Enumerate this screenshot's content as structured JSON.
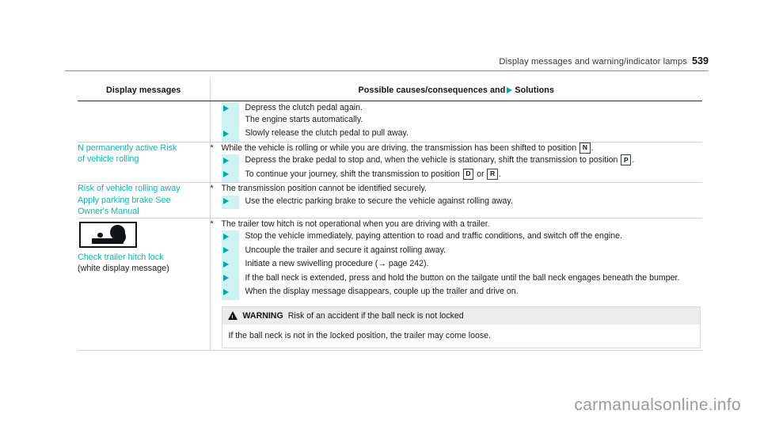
{
  "page_header": {
    "title": "Display messages and warning/indicator lamps",
    "page_number": "539"
  },
  "table": {
    "columns": [
      {
        "label": "Display messages"
      },
      {
        "label_before_icon": "Possible causes/consequences and",
        "icon": "solid-triangle-icon",
        "label_after_icon": "Solutions"
      }
    ],
    "rows": [
      {
        "display_message_lines": [],
        "causes": [
          {
            "marker": "",
            "text": "",
            "solutions": [
              "Depress the clutch pedal again.\nThe engine starts automatically.",
              "Slowly release the clutch pedal to pull away."
            ]
          }
        ]
      },
      {
        "display_message_lines": [
          "N permanently active Risk",
          "of vehicle rolling"
        ],
        "causes": [
          {
            "marker": "*",
            "text_before_badge": "While the vehicle is rolling or while you are driving, the transmission has been shifted to position",
            "badge": "N",
            "text_after_badge": ".",
            "solutions": [
              {
                "text_before_badge": "Depress the brake pedal to stop and, when the vehicle is stationary, shift the transmission to position",
                "badge": "P",
                "text_after_badge": "."
              },
              {
                "text_before_badge": "To continue your journey, shift the transmission to position",
                "badge": "D",
                "conjunction": "or",
                "badge2": "R",
                "text_after_badge": "."
              }
            ]
          }
        ]
      },
      {
        "display_message_lines": [
          "Risk of vehicle rolling away",
          "Apply parking brake See",
          "Owner's Manual"
        ],
        "causes": [
          {
            "marker": "*",
            "text": "The transmission position cannot be identified securely.",
            "solutions": [
              "Use the electric parking brake to secure the vehicle against rolling away."
            ]
          }
        ]
      },
      {
        "pictogram": "trailer-hitch-icon",
        "display_message_lines": [
          "Check trailer hitch lock"
        ],
        "display_message_note": "(white display message)",
        "causes": [
          {
            "marker": "*",
            "text": "The trailer tow hitch is not operational when you are driving with a trailer.",
            "solutions": [
              "Stop the vehicle immediately, paying attention to road and traffic conditions, and switch off the engine.",
              "Uncouple the trailer and secure it against rolling away.",
              "Initiate a new swivelling procedure (→ page 242).",
              "If the ball neck is extended, press and hold the button on the tailgate until the ball neck engages beneath the bumper.",
              "When the display message disappears, couple up the trailer and drive on."
            ]
          }
        ],
        "warning": {
          "label": "WARNING",
          "title": "Risk of an accident if the ball neck is not locked",
          "body": "If the ball neck is not in the locked position, the trailer may come loose."
        }
      }
    ]
  },
  "watermark": "carmanualsonline.info",
  "colors": {
    "teal_text": "#17b2ae",
    "teal_marker": "#00a7a3",
    "spine": "#cdf2f1",
    "warning_header_bg": "#ececec"
  }
}
